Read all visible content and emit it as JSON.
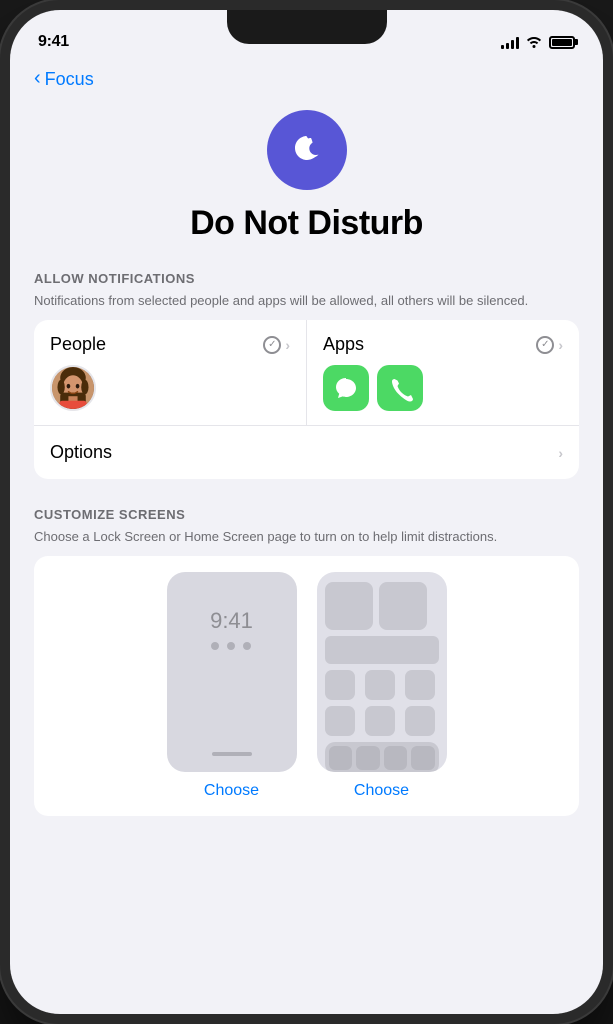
{
  "statusBar": {
    "time": "9:41",
    "signalBars": [
      3,
      6,
      9,
      12,
      14
    ],
    "wifi": true,
    "battery": true
  },
  "navigation": {
    "backLabel": "Focus",
    "backChevron": "‹"
  },
  "hero": {
    "title": "Do Not Disturb",
    "iconColor": "#5856D6"
  },
  "allowNotifications": {
    "sectionLabel": "ALLOW NOTIFICATIONS",
    "description": "Notifications from selected people and apps will be allowed, all others will be silenced.",
    "people": {
      "title": "People"
    },
    "apps": {
      "title": "Apps"
    },
    "options": {
      "title": "Options"
    }
  },
  "customizeScreens": {
    "sectionLabel": "CUSTOMIZE SCREENS",
    "description": "Choose a Lock Screen or Home Screen page to turn on to help limit distractions.",
    "preview1": {
      "time": "9:41",
      "chooseLabel": "Choose"
    },
    "preview2": {
      "chooseLabel": "Choose"
    }
  }
}
